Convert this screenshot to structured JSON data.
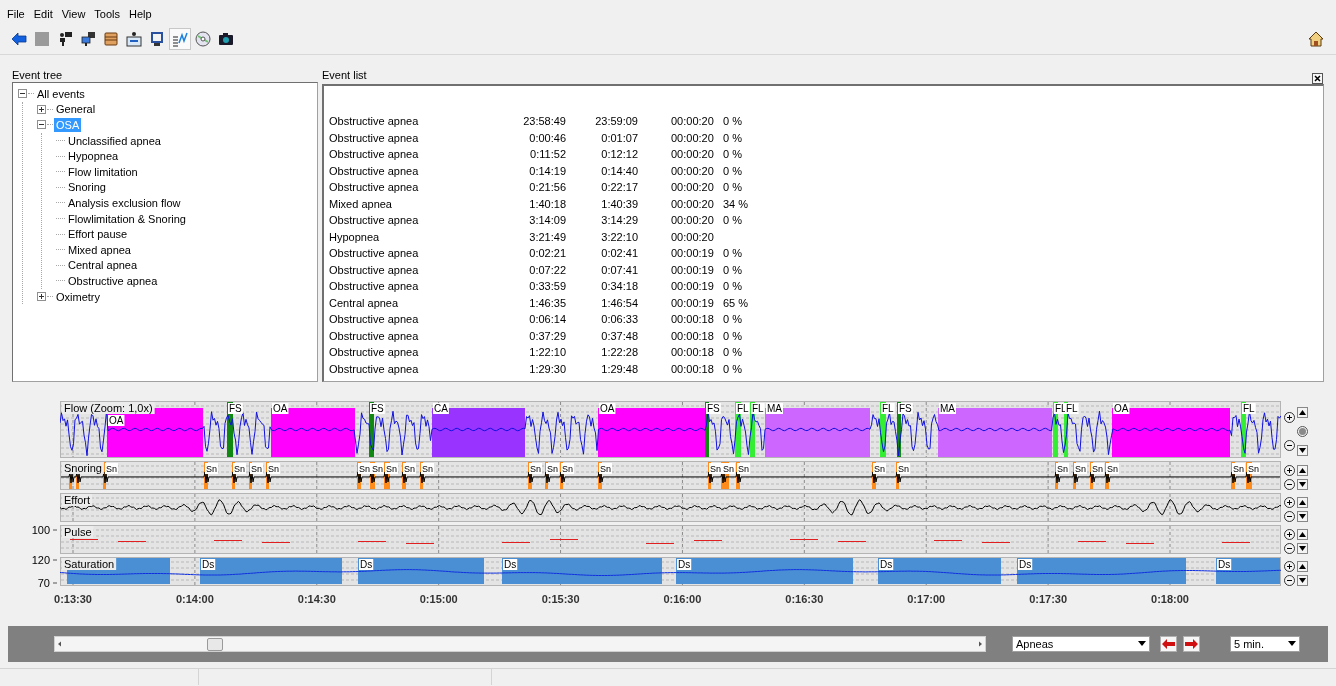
{
  "menu": [
    "File",
    "Edit",
    "View",
    "Tools",
    "Help"
  ],
  "toolbar": [
    {
      "pressed": false
    },
    {
      "pressed": false
    },
    {
      "pressed": false
    },
    {
      "pressed": false
    },
    {
      "pressed": false
    },
    {
      "pressed": false
    },
    {
      "pressed": false
    },
    {
      "pressed": true
    },
    {
      "pressed": false
    },
    {
      "pressed": false
    }
  ],
  "event_tree": {
    "title": "Event tree",
    "nodes": [
      {
        "label": "All events",
        "expanded": true,
        "selected": false,
        "children": [
          {
            "label": "General",
            "expanded": false,
            "selected": false
          },
          {
            "label": "OSA",
            "expanded": true,
            "selected": true,
            "children": [
              {
                "label": "Unclassified apnea",
                "selected": false
              },
              {
                "label": "Hypopnea",
                "selected": false
              },
              {
                "label": "Flow limitation",
                "selected": false
              },
              {
                "label": "Snoring",
                "selected": false
              },
              {
                "label": "Analysis exclusion flow",
                "selected": false
              },
              {
                "label": "Flowlimitation & Snoring",
                "selected": false
              },
              {
                "label": "Effort pause",
                "selected": false
              },
              {
                "label": "Mixed apnea",
                "selected": false
              },
              {
                "label": "Central apnea",
                "selected": false
              },
              {
                "label": "Obstructive apnea",
                "selected": false
              }
            ]
          },
          {
            "label": "Oximetry",
            "expanded": false,
            "selected": false
          }
        ]
      }
    ]
  },
  "event_list": {
    "title": "Event list",
    "rows": [
      {
        "name": "Obstructive apnea",
        "start": "23:58:49",
        "end": "23:59:09",
        "duration": "00:00:20",
        "percent": "0 %"
      },
      {
        "name": "Obstructive apnea",
        "start": "0:00:46",
        "end": "0:01:07",
        "duration": "00:00:20",
        "percent": "0 %"
      },
      {
        "name": "Obstructive apnea",
        "start": "0:11:52",
        "end": "0:12:12",
        "duration": "00:00:20",
        "percent": "0 %"
      },
      {
        "name": "Obstructive apnea",
        "start": "0:14:19",
        "end": "0:14:40",
        "duration": "00:00:20",
        "percent": "0 %"
      },
      {
        "name": "Obstructive apnea",
        "start": "0:21:56",
        "end": "0:22:17",
        "duration": "00:00:20",
        "percent": "0 %"
      },
      {
        "name": "Mixed apnea",
        "start": "1:40:18",
        "end": "1:40:39",
        "duration": "00:00:20",
        "percent": "34 %"
      },
      {
        "name": "Obstructive apnea",
        "start": "3:14:09",
        "end": "3:14:29",
        "duration": "00:00:20",
        "percent": "0 %"
      },
      {
        "name": "Hypopnea",
        "start": "3:21:49",
        "end": "3:22:10",
        "duration": "00:00:20"
      },
      {
        "name": "Obstructive apnea",
        "start": "0:02:21",
        "end": "0:02:41",
        "duration": "00:00:19",
        "percent": "0 %"
      },
      {
        "name": "Obstructive apnea",
        "start": "0:07:22",
        "end": "0:07:41",
        "duration": "00:00:19",
        "percent": "0 %"
      },
      {
        "name": "Obstructive apnea",
        "start": "0:33:59",
        "end": "0:34:18",
        "duration": "00:00:19",
        "percent": "0 %"
      },
      {
        "name": "Central apnea",
        "start": "1:46:35",
        "end": "1:46:54",
        "duration": "00:00:19",
        "percent": "65 %"
      },
      {
        "name": "Obstructive apnea",
        "start": "0:06:14",
        "end": "0:06:33",
        "duration": "00:00:18",
        "percent": "0 %"
      },
      {
        "name": "Obstructive apnea",
        "start": "0:37:29",
        "end": "0:37:48",
        "duration": "00:00:18",
        "percent": "0 %"
      },
      {
        "name": "Obstructive apnea",
        "start": "1:22:10",
        "end": "1:22:28",
        "duration": "00:00:18",
        "percent": "0 %"
      },
      {
        "name": "Obstructive apnea",
        "start": "1:29:30",
        "end": "1:29:48",
        "duration": "00:00:18",
        "percent": "0 %"
      }
    ]
  },
  "signals": {
    "time_ticks": [
      "0:13:30",
      "0:14:00",
      "0:14:30",
      "0:15:00",
      "0:15:30",
      "0:16:00",
      "0:16:30",
      "0:17:00",
      "0:17:30",
      "0:18:00"
    ],
    "channels": [
      {
        "kind": "flow",
        "label": "Flow (Zoom: 1,0x)",
        "events": [
          {
            "label": "OA",
            "color": "#ff00ff"
          },
          {
            "label": "FS",
            "color": "#118811"
          },
          {
            "label": "OA",
            "color": "#ff00ff"
          },
          {
            "label": "FS",
            "color": "#118811"
          },
          {
            "label": "CA",
            "color": "#9933ff"
          },
          {
            "label": "OA",
            "color": "#ff00ff"
          },
          {
            "label": "FS",
            "color": "#118811"
          },
          {
            "label": "FL",
            "color": "#33ee33"
          },
          {
            "label": "FL",
            "color": "#33ee33"
          },
          {
            "label": "MA",
            "color": "#cc66ff"
          },
          {
            "label": "FL",
            "color": "#33ee33"
          },
          {
            "label": "FS",
            "color": "#118811"
          },
          {
            "label": "MA",
            "color": "#cc66ff"
          },
          {
            "label": "FL",
            "color": "#33ee33"
          },
          {
            "label": "FL",
            "color": "#33ee33"
          },
          {
            "label": "OA",
            "color": "#ff00ff"
          },
          {
            "label": "FL",
            "color": "#33ee33"
          }
        ]
      },
      {
        "kind": "snoring",
        "label": "Snoring",
        "events": [
          {
            "color": "#ff8c1a"
          },
          {
            "color": "#ff8c1a"
          },
          {
            "label": "Sn",
            "color": "#ff8c1a"
          },
          {
            "label": "Sn",
            "color": "#ff8c1a"
          },
          {
            "label": "Sn",
            "color": "#ff8c1a"
          },
          {
            "label": "Sn",
            "color": "#ff8c1a"
          },
          {
            "label": "Sn",
            "color": "#ff8c1a"
          },
          {
            "label": "Sn",
            "color": "#ff8c1a"
          },
          {
            "label": "Sn",
            "color": "#ff8c1a"
          },
          {
            "label": "Sn",
            "color": "#ff8c1a"
          },
          {
            "label": "Sn",
            "color": "#ff8c1a"
          },
          {
            "label": "Sn",
            "color": "#ff8c1a"
          },
          {
            "label": "Sn",
            "color": "#ff8c1a"
          },
          {
            "label": "Sn",
            "color": "#ff8c1a"
          },
          {
            "label": "Sn",
            "color": "#ff8c1a"
          },
          {
            "label": "Sn",
            "color": "#ff8c1a"
          },
          {
            "label": "Sn",
            "color": "#ff8c1a"
          },
          {
            "label": "Sn",
            "color": "#ff8c1a"
          },
          {
            "label": "Sn",
            "color": "#ff8c1a"
          },
          {
            "label": "Sn",
            "color": "#ff8c1a"
          },
          {
            "label": "Sn",
            "color": "#ff8c1a"
          },
          {
            "label": "Sn",
            "color": "#ff8c1a"
          },
          {
            "label": "Sn",
            "color": "#ff8c1a"
          },
          {
            "label": "Sn",
            "color": "#ff8c1a"
          },
          {
            "label": "Sn",
            "color": "#ff8c1a"
          },
          {
            "label": "Sn",
            "color": "#ff8c1a"
          },
          {
            "label": "Sn",
            "color": "#ff8c1a"
          }
        ]
      },
      {
        "kind": "effort",
        "label": "Effort"
      },
      {
        "kind": "pulse",
        "label": "Pulse",
        "scale": [
          "100"
        ]
      },
      {
        "kind": "saturation",
        "label": "Saturation",
        "scale": [
          "120",
          "70"
        ],
        "events": [
          {
            "color": "#4a8fd4"
          },
          {
            "label": "Ds",
            "color": "#4a8fd4"
          },
          {
            "label": "Ds",
            "color": "#4a8fd4"
          },
          {
            "label": "Ds",
            "color": "#4a8fd4"
          },
          {
            "label": "Ds",
            "color": "#4a8fd4"
          },
          {
            "label": "Ds",
            "color": "#4a8fd4"
          },
          {
            "label": "Ds",
            "color": "#4a8fd4"
          },
          {
            "label": "Ds",
            "color": "#4a8fd4"
          }
        ]
      }
    ]
  },
  "navigation": {
    "event_filter": "Apneas",
    "span": "5 min."
  }
}
